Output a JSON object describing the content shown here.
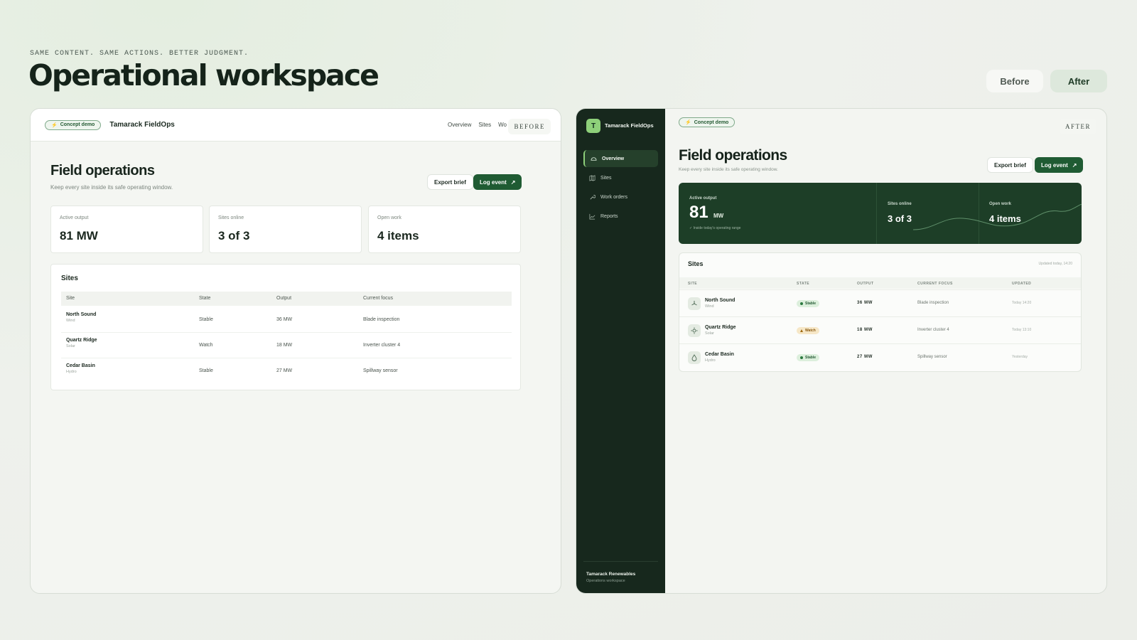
{
  "header": {
    "eyebrow": "SAME CONTENT. SAME ACTIONS. BETTER JUDGMENT.",
    "title": "Operational workspace",
    "toggle_before": "Before",
    "toggle_after": "After"
  },
  "before": {
    "tag": "BEFORE",
    "chip": "Concept demo",
    "brand": "Tamarack FieldOps",
    "nav": [
      "Overview",
      "Sites",
      "Wo"
    ],
    "title": "Field operations",
    "subtitle": "Keep every site inside its safe operating window.",
    "export_label": "Export brief",
    "log_label": "Log event",
    "cards": [
      {
        "label": "Active output",
        "value": "81 MW"
      },
      {
        "label": "Sites online",
        "value": "3 of 3"
      },
      {
        "label": "Open work",
        "value": "4 items"
      }
    ],
    "table_title": "Sites",
    "columns": [
      "Site",
      "State",
      "Output",
      "Current focus"
    ],
    "rows": [
      {
        "name": "North Sound",
        "type": "Wind",
        "state": "Stable",
        "output": "36 MW",
        "focus": "Blade inspection"
      },
      {
        "name": "Quartz Ridge",
        "type": "Solar",
        "state": "Watch",
        "output": "18 MW",
        "focus": "Inverter cluster 4"
      },
      {
        "name": "Cedar Basin",
        "type": "Hydro",
        "state": "Stable",
        "output": "27 MW",
        "focus": "Spillway sensor"
      }
    ]
  },
  "after": {
    "tag": "AFTER",
    "logo_letter": "T",
    "brand": "Tamarack FieldOps",
    "nav": [
      "Overview",
      "Sites",
      "Work orders",
      "Reports"
    ],
    "footer_org": "Tamarack Renewables",
    "footer_sub": "Operations workspace",
    "chip": "Concept demo",
    "title": "Field operations",
    "subtitle": "Keep every site inside its safe operating window.",
    "export_label": "Export brief",
    "log_label": "Log event",
    "hero": {
      "output_label": "Active output",
      "output_value": "81",
      "output_unit": "MW",
      "output_note": "Inside today's operating range",
      "sites_label": "Sites online",
      "sites_value": "3 of 3",
      "work_label": "Open work",
      "work_value": "4 items"
    },
    "table_title": "Sites",
    "updated": "Updated today, 14:20",
    "columns": [
      "SITE",
      "STATE",
      "OUTPUT",
      "CURRENT FOCUS",
      "UPDATED"
    ],
    "rows": [
      {
        "name": "North Sound",
        "type": "Wind",
        "state": "Stable",
        "output": "36 MW",
        "focus": "Blade inspection",
        "updated": "Today 14:20",
        "icon": "wind-icon"
      },
      {
        "name": "Quartz Ridge",
        "type": "Solar",
        "state": "Watch",
        "output": "18 MW",
        "focus": "Inverter cluster 4",
        "updated": "Today 13:10",
        "icon": "sun-icon"
      },
      {
        "name": "Cedar Basin",
        "type": "Hydro",
        "state": "Stable",
        "output": "27 MW",
        "focus": "Spillway sensor",
        "updated": "Yesterday",
        "icon": "droplet-icon"
      }
    ]
  },
  "colors": {
    "accent": "#1f5b33",
    "sidebar": "#17281d",
    "hero": "#1d3e27",
    "stable": "#2d7a40",
    "watch": "#a06a10"
  }
}
